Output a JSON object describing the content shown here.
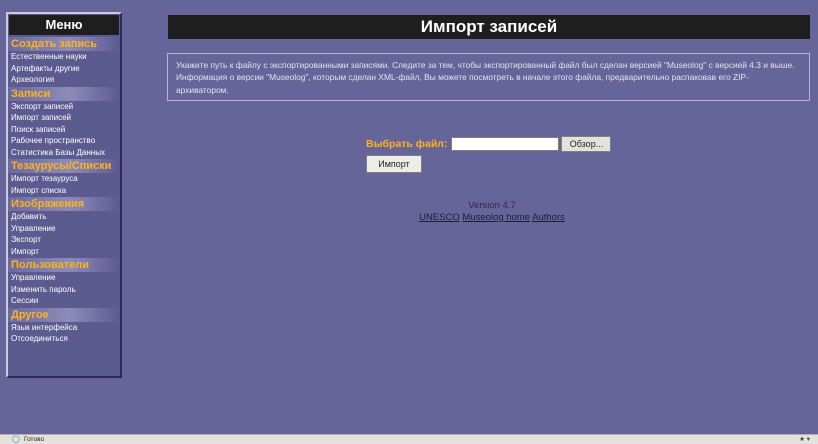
{
  "sidebar": {
    "title": "Меню",
    "sections": [
      {
        "heading": "Создать запись",
        "items": [
          "Естественные науки",
          "Артефакты другие",
          "Археология"
        ]
      },
      {
        "heading": "Записи",
        "items": [
          "Экспорт записей",
          "Импорт записей",
          "Поиск записей",
          "Рабочее пространство",
          "Статистика Базы Данных"
        ]
      },
      {
        "heading": "Тезаурусы/Списки",
        "items": [
          "Импорт тезауруса",
          "Импорт списка"
        ]
      },
      {
        "heading": "Изображения",
        "items": [
          "Добавить",
          "Управление",
          "Экспорт",
          "Импорт"
        ]
      },
      {
        "heading": "Пользователи",
        "items": [
          "Управление",
          "Изменить пароль",
          "Сессии"
        ]
      },
      {
        "heading": "Другое",
        "items": [
          "Язык интерфейса",
          "Отсоединиться"
        ]
      }
    ]
  },
  "page": {
    "title": "Импорт записей",
    "info": "Укажите путь к файлу с экспортированными записями. Следите за тем, чтобы экспортированный файл был сделан версией \"Museolog\" с версией 4.3 и выше. Информация о версии \"Museolog\", которым сделан XML-файл, Вы можете посмотреть в начале этого файла, предварительно распаковав его ZIP-архиватором."
  },
  "form": {
    "file_label": "Выбрать файл:",
    "file_value": "",
    "browse_label": "Обзор...",
    "import_label": "Импорт"
  },
  "footer": {
    "version": "Version 4.7",
    "links": [
      "UNESCO",
      "Museolog home",
      "Authors"
    ]
  },
  "status_bar": {
    "text": "Готово",
    "icon": "page-icon",
    "right": "★ ▾"
  },
  "colors": {
    "background": "#66659a",
    "accent": "#ffb21a",
    "title_bar": "#1e1e1e"
  }
}
